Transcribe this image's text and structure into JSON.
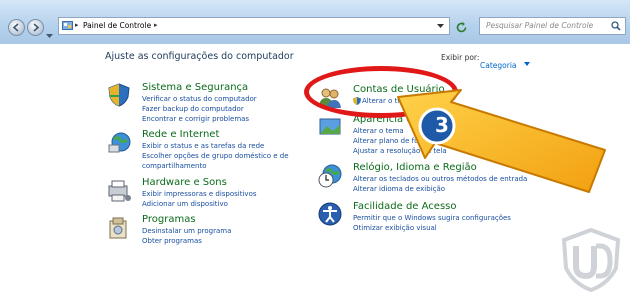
{
  "window": {
    "breadcrumb": "Painel de Controle",
    "search_placeholder": "Pesquisar Painel de Controle"
  },
  "main": {
    "heading": "Ajuste as configurações do computador",
    "view_by_label": "Exibir por:",
    "view_by_value": "Categoria"
  },
  "categories_left": [
    {
      "title": "Sistema e Segurança",
      "links": [
        "Verificar o status do computador",
        "Fazer backup do computador",
        "Encontrar e corrigir problemas"
      ]
    },
    {
      "title": "Rede e Internet",
      "links": [
        "Exibir o status e as tarefas da rede",
        "Escolher opções de grupo doméstico e de",
        "compartilhamento"
      ]
    },
    {
      "title": "Hardware e Sons",
      "links": [
        "Exibir impressoras e dispositivos",
        "Adicionar um dispositivo"
      ]
    },
    {
      "title": "Programas",
      "links": [
        "Desinstalar um programa",
        "Obter programas"
      ]
    }
  ],
  "categories_right": [
    {
      "title": "Contas de Usuário",
      "links": [
        "Alterar o tipo de conta"
      ]
    },
    {
      "title": "Aparência e Pe",
      "links": [
        "Alterar o tema",
        "Alterar plano de fundo da",
        "Ajustar a resolução da tela"
      ]
    },
    {
      "title": "Relógio, Idioma e Região",
      "links": [
        "Alterar os teclados ou outros métodos de entrada",
        "Alterar idioma de exibição"
      ]
    },
    {
      "title": "Facilidade de Acesso",
      "links": [
        "Permitir que o Windows sugira configurações",
        "Otimizar exibição visual"
      ]
    }
  ],
  "annotation": {
    "step_number": "3"
  },
  "colors": {
    "highlight_oval": "#e01818",
    "arrow_fill": "#f7b21c",
    "category_title": "#0b6b1b",
    "link": "#1a4fa0"
  }
}
